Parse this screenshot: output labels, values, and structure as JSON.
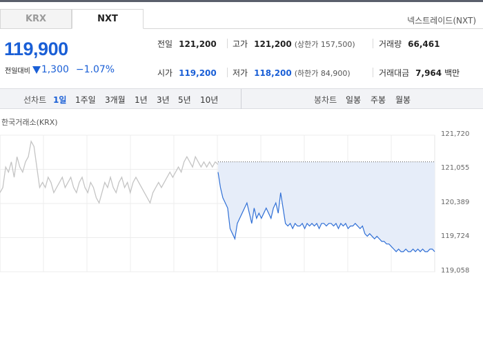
{
  "tabs": [
    {
      "label": "KRX",
      "active": false
    },
    {
      "label": "NXT",
      "active": true
    }
  ],
  "market_name": "넥스트레이드(NXT)",
  "price": {
    "current": "119,900",
    "change_label": "전일대비",
    "change_amount": "1,300",
    "change_percent": "−1.07%",
    "direction": "down"
  },
  "stats": {
    "prev_close": {
      "label": "전일",
      "value": "121,200"
    },
    "high": {
      "label": "고가",
      "value": "121,200",
      "sub": "(상한가 157,500)"
    },
    "volume": {
      "label": "거래량",
      "value": "66,461"
    },
    "open": {
      "label": "시가",
      "value": "119,200"
    },
    "low": {
      "label": "저가",
      "value": "118,200",
      "sub": "(하한가 84,900)"
    },
    "trade_value": {
      "label": "거래대금",
      "value": "7,964",
      "unit": "백만"
    }
  },
  "period_bar": {
    "line_chart": {
      "title": "선차트",
      "options": [
        "1일",
        "1주일",
        "3개월",
        "1년",
        "3년",
        "5년",
        "10년"
      ],
      "selected": "1일"
    },
    "candle_chart": {
      "title": "봉차트",
      "options": [
        "일봉",
        "주봉",
        "월봉"
      ]
    }
  },
  "chart_caption": "한국거래소(KRX)",
  "colors": {
    "accent": "#1a5fd6",
    "krx_line": "#c4c4c4",
    "nxt_line": "#2f6fd6",
    "fill": "#e6edf9"
  },
  "chart_data": {
    "type": "line",
    "title": "",
    "xlabel": "",
    "ylabel": "",
    "yticks": [
      121720,
      121055,
      120389,
      119724,
      119058
    ],
    "ylim": [
      119058,
      121720
    ],
    "reference_line": 121200,
    "grid": true,
    "series": [
      {
        "name": "",
        "style": "gray",
        "values": [
          120600,
          120700,
          121100,
          121000,
          121200,
          120900,
          121300,
          121100,
          121000,
          121200,
          121300,
          121600,
          121500,
          121100,
          120700,
          120800,
          120700,
          120900,
          120800,
          120600,
          120700,
          120800,
          120900,
          120700,
          120800,
          120900,
          120700,
          120600,
          120800,
          120900,
          120700,
          120600,
          120800,
          120700,
          120500,
          120400,
          120600,
          120800,
          120700,
          120900,
          120700,
          120600,
          120800,
          120900,
          120700,
          120800,
          120600,
          120800,
          120900,
          120800,
          120700,
          120600,
          120500,
          120400,
          120600,
          120700,
          120800,
          120700,
          120800,
          120900,
          121000,
          120900,
          121000,
          121100,
          121000,
          121200,
          121300,
          121200,
          121100,
          121300,
          121200,
          121100,
          121200,
          121100,
          121200,
          121100,
          121200,
          121150
        ]
      },
      {
        "name": "",
        "style": "blue",
        "values": [
          121000,
          120700,
          120500,
          120400,
          120300,
          119900,
          119800,
          119700,
          120000,
          120100,
          120200,
          120300,
          120400,
          120200,
          120000,
          120300,
          120100,
          120200,
          120100,
          120200,
          120300,
          120200,
          120100,
          120300,
          120400,
          120200,
          120600,
          120300,
          120000,
          119950,
          120000,
          119900,
          120000,
          119950,
          119950,
          120000,
          119900,
          120000,
          119950,
          120000,
          119950,
          120000,
          119900,
          120000,
          120000,
          119950,
          120000,
          120000,
          119950,
          120000,
          119900,
          120000,
          119950,
          120000,
          119900,
          119950,
          119950,
          120000,
          119950,
          119900,
          119950,
          119800,
          119750,
          119800,
          119750,
          119700,
          119750,
          119700,
          119650,
          119650,
          119600,
          119600,
          119550,
          119500,
          119450,
          119500,
          119450,
          119450,
          119500,
          119450,
          119450,
          119500,
          119450,
          119500,
          119450,
          119500,
          119450,
          119450,
          119500,
          119500,
          119450
        ]
      }
    ]
  }
}
